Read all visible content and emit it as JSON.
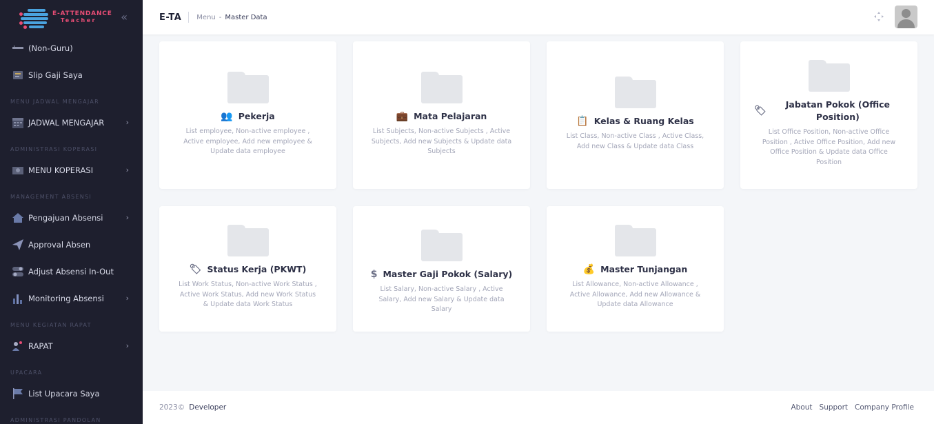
{
  "sidebar": {
    "logo_line1": "E-ATTENDANCE",
    "logo_line2": "Teacher",
    "collapse_glyph": "«",
    "items": [
      {
        "type": "item",
        "label": "(Non-Guru)",
        "icon": "ruler-icon",
        "chevron": false
      },
      {
        "type": "item",
        "label": "Slip Gaji Saya",
        "icon": "payslip-icon",
        "chevron": false
      },
      {
        "type": "heading",
        "label": "MENU JADWAL MENGAJAR"
      },
      {
        "type": "item",
        "label": "JADWAL MENGAJAR",
        "icon": "calendar-icon",
        "chevron": true
      },
      {
        "type": "heading",
        "label": "ADMINISTRASI KOPERASI"
      },
      {
        "type": "item",
        "label": "MENU KOPERASI",
        "icon": "cooperative-icon",
        "chevron": true
      },
      {
        "type": "heading",
        "label": "MANAGEMENT ABSENSI"
      },
      {
        "type": "item",
        "label": "Pengajuan Absensi",
        "icon": "home-icon",
        "chevron": true
      },
      {
        "type": "item",
        "label": "Approval Absen",
        "icon": "paper-plane-icon",
        "chevron": false
      },
      {
        "type": "item",
        "label": "Adjust Absensi In-Out",
        "icon": "toggle-icon",
        "chevron": false
      },
      {
        "type": "item",
        "label": "Monitoring Absensi",
        "icon": "bar-chart-icon",
        "chevron": true
      },
      {
        "type": "heading",
        "label": "MENU KEGIATAN RAPAT"
      },
      {
        "type": "item",
        "label": "RAPAT",
        "icon": "meeting-icon",
        "chevron": true
      },
      {
        "type": "heading",
        "label": "UPACARA"
      },
      {
        "type": "item",
        "label": "List Upacara Saya",
        "icon": "flag-icon",
        "chevron": false
      },
      {
        "type": "heading",
        "label": "ADMINISTRASI PANDOLAN"
      }
    ]
  },
  "topbar": {
    "brand": "E-TA",
    "crumb_root": "Menu",
    "crumb_sep": "-",
    "crumb_current": "Master Data"
  },
  "cards": [
    {
      "title": "Pekerja",
      "icon": "users-icon",
      "icon_glyph": "👥",
      "desc": "List employee, Non-active employee , Active employee, Add new employee & Update data employee"
    },
    {
      "title": "Mata Pelajaran",
      "icon": "briefcase-icon",
      "icon_glyph": "💼",
      "desc": "List Subjects, Non-active Subjects , Active Subjects, Add new Subjects & Update data Subjects"
    },
    {
      "title": "Kelas & Ruang Kelas",
      "icon": "clipboard-icon",
      "icon_glyph": "📋",
      "desc": "List Class, Non-active Class , Active Class, Add new Class & Update data Class"
    },
    {
      "title": "Jabatan Pokok (Office Position)",
      "icon": "tags-icon",
      "icon_glyph": "🏷",
      "desc": "List Office Position, Non-active Office Position , Active Office Position, Add new Office Position & Update data Office Position"
    },
    {
      "title": "Status Kerja (PKWT)",
      "icon": "tag-icon",
      "icon_glyph": "🏷",
      "desc": "List Work Status, Non-active Work Status , Active Work Status, Add new Work Status & Update data Work Status"
    },
    {
      "title": "Master Gaji Pokok (Salary)",
      "icon": "dollar-icon",
      "icon_glyph": "$",
      "desc": "List Salary, Non-active Salary , Active Salary, Add new Salary & Update data Salary"
    },
    {
      "title": "Master Tunjangan",
      "icon": "money-bag-icon",
      "icon_glyph": "💰",
      "desc": "List Allowance, Non-active Allowance , Active Allowance, Add new Allowance & Update data Allowance"
    }
  ],
  "footer": {
    "copyright": "2023©",
    "developer": "Developer",
    "links": [
      "About",
      "Support",
      "Company Profile"
    ]
  },
  "colors": {
    "sidebar_bg": "#1e1f2e",
    "accent": "#e94d75",
    "page_bg": "#f4f6f9",
    "folder": "#e4e6ea"
  }
}
